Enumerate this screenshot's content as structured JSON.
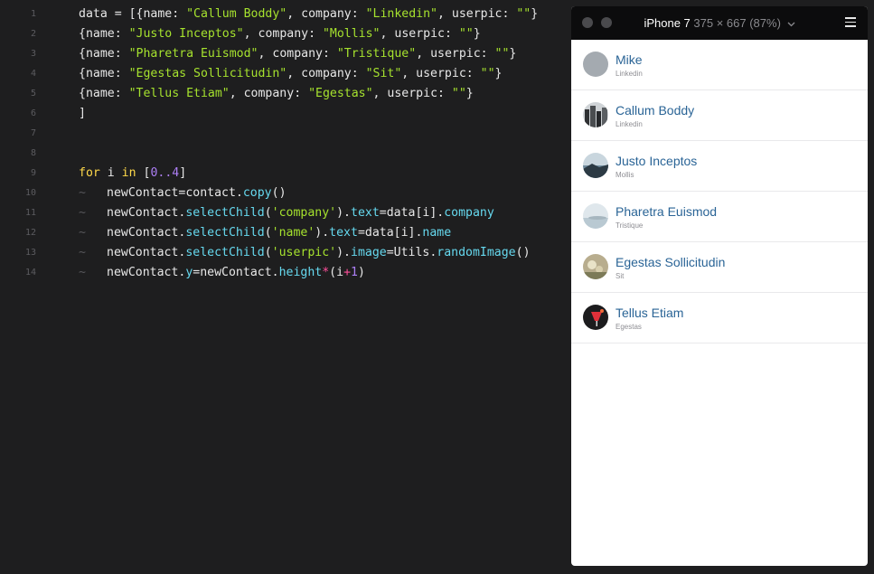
{
  "editor": {
    "lines": [
      {
        "num": "1",
        "parts": [
          [
            "c",
            "data = [{name: "
          ],
          [
            "s",
            "\"Callum Boddy\""
          ],
          [
            "c",
            ", company: "
          ],
          [
            "s",
            "\"Linkedin\""
          ],
          [
            "c",
            ", userpic: "
          ],
          [
            "s",
            "\"\""
          ],
          [
            "c",
            "}"
          ]
        ]
      },
      {
        "num": "2",
        "parts": [
          [
            "c",
            "{name: "
          ],
          [
            "s",
            "\"Justo Inceptos\""
          ],
          [
            "c",
            ", company: "
          ],
          [
            "s",
            "\"Mollis\""
          ],
          [
            "c",
            ", userpic: "
          ],
          [
            "s",
            "\"\""
          ],
          [
            "c",
            "}"
          ]
        ]
      },
      {
        "num": "3",
        "parts": [
          [
            "c",
            "{name: "
          ],
          [
            "s",
            "\"Pharetra Euismod\""
          ],
          [
            "c",
            ", company: "
          ],
          [
            "s",
            "\"Tristique\""
          ],
          [
            "c",
            ", userpic: "
          ],
          [
            "s",
            "\"\""
          ],
          [
            "c",
            "}"
          ]
        ]
      },
      {
        "num": "4",
        "parts": [
          [
            "c",
            "{name: "
          ],
          [
            "s",
            "\"Egestas Sollicitudin\""
          ],
          [
            "c",
            ", company: "
          ],
          [
            "s",
            "\"Sit\""
          ],
          [
            "c",
            ", userpic: "
          ],
          [
            "s",
            "\"\""
          ],
          [
            "c",
            "}"
          ]
        ]
      },
      {
        "num": "5",
        "parts": [
          [
            "c",
            "{name: "
          ],
          [
            "s",
            "\"Tellus Etiam\""
          ],
          [
            "c",
            ", company: "
          ],
          [
            "s",
            "\"Egestas\""
          ],
          [
            "c",
            ", userpic: "
          ],
          [
            "s",
            "\"\""
          ],
          [
            "c",
            "}"
          ]
        ]
      },
      {
        "num": "6",
        "parts": [
          [
            "c",
            "]"
          ]
        ]
      },
      {
        "num": "7",
        "parts": []
      },
      {
        "num": "8",
        "parts": []
      },
      {
        "num": "9",
        "parts": [
          [
            "k",
            "for"
          ],
          [
            "c",
            " i "
          ],
          [
            "k",
            "in"
          ],
          [
            "c",
            " ["
          ],
          [
            "n",
            "0..4"
          ],
          [
            "c",
            "]"
          ]
        ]
      },
      {
        "num": "10",
        "tilde": "~",
        "parts": [
          [
            "c",
            "newContact=contact."
          ],
          [
            "m",
            "copy"
          ],
          [
            "c",
            "()"
          ]
        ]
      },
      {
        "num": "11",
        "tilde": "~",
        "parts": [
          [
            "c",
            "newContact."
          ],
          [
            "m",
            "selectChild"
          ],
          [
            "c",
            "("
          ],
          [
            "s",
            "'company'"
          ],
          [
            "c",
            ")."
          ],
          [
            "m",
            "text"
          ],
          [
            "c",
            "=data[i]."
          ],
          [
            "m",
            "company"
          ]
        ]
      },
      {
        "num": "12",
        "tilde": "~",
        "parts": [
          [
            "c",
            "newContact."
          ],
          [
            "m",
            "selectChild"
          ],
          [
            "c",
            "("
          ],
          [
            "s",
            "'name'"
          ],
          [
            "c",
            ")."
          ],
          [
            "m",
            "text"
          ],
          [
            "c",
            "=data[i]."
          ],
          [
            "m",
            "name"
          ]
        ]
      },
      {
        "num": "13",
        "tilde": "~",
        "parts": [
          [
            "c",
            "newContact."
          ],
          [
            "m",
            "selectChild"
          ],
          [
            "c",
            "("
          ],
          [
            "s",
            "'userpic'"
          ],
          [
            "c",
            ")."
          ],
          [
            "m",
            "image"
          ],
          [
            "c",
            "=Utils."
          ],
          [
            "m",
            "randomImage"
          ],
          [
            "c",
            "()"
          ]
        ]
      },
      {
        "num": "14",
        "tilde": "~",
        "parts": [
          [
            "c",
            "newContact."
          ],
          [
            "m",
            "y"
          ],
          [
            "c",
            "=newContact."
          ],
          [
            "m",
            "height"
          ],
          [
            "p",
            "*"
          ],
          [
            "c",
            "(i"
          ],
          [
            "p",
            "+"
          ],
          [
            "n",
            "1"
          ],
          [
            "c",
            ")"
          ]
        ]
      }
    ]
  },
  "preview": {
    "device_name": "iPhone 7",
    "device_size": "375 × 667 (87%)",
    "dropdown_icon": "chevron-down-icon",
    "menu_icon": "hamburger-menu-icon",
    "contacts": [
      {
        "name": "Mike",
        "company": "Linkedin",
        "avatar": "gray"
      },
      {
        "name": "Callum Boddy",
        "company": "Linkedin",
        "avatar": "city"
      },
      {
        "name": "Justo Inceptos",
        "company": "Mollis",
        "avatar": "coast"
      },
      {
        "name": "Pharetra Euismod",
        "company": "Tristique",
        "avatar": "sky"
      },
      {
        "name": "Egestas Sollicitudin",
        "company": "Sit",
        "avatar": "flower"
      },
      {
        "name": "Tellus Etiam",
        "company": "Egestas",
        "avatar": "drink"
      }
    ]
  },
  "colors": {
    "editor_bg": "#1e1e1f",
    "string": "#a6e22e",
    "keyword": "#ffd94a",
    "number": "#ad7ff5",
    "method": "#66d9ef",
    "contact_name": "#2a6496"
  }
}
